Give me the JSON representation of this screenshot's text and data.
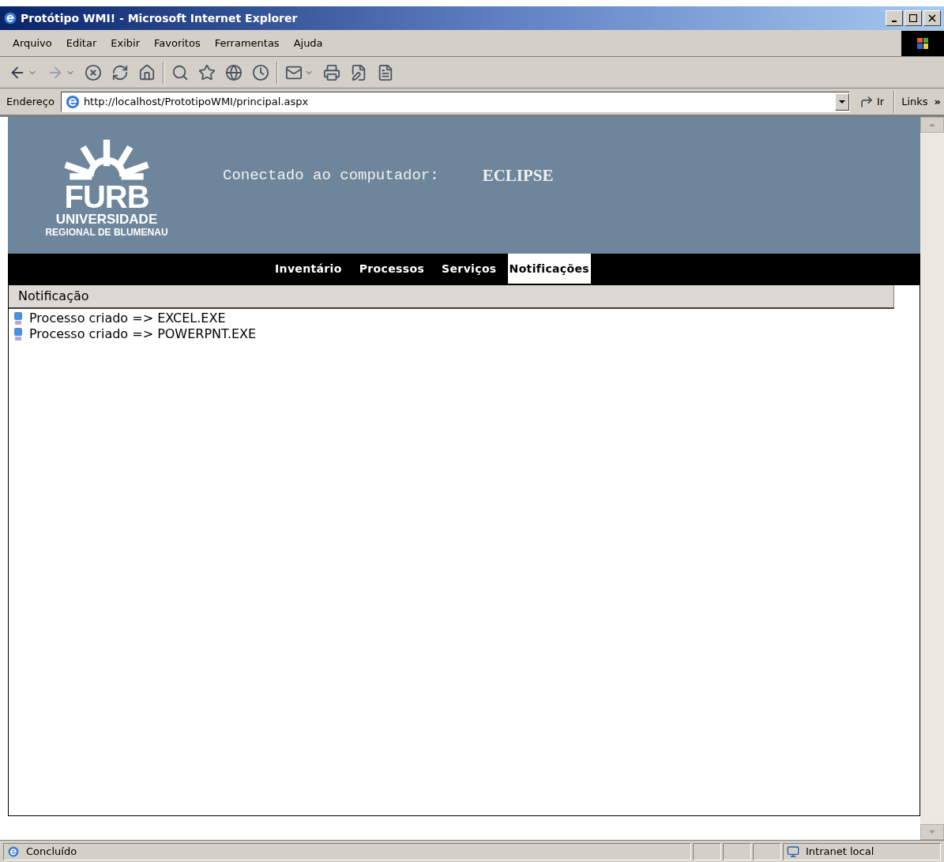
{
  "window": {
    "title": "Protótipo WMI! - Microsoft Internet Explorer"
  },
  "menu": [
    "Arquivo",
    "Editar",
    "Exibir",
    "Favoritos",
    "Ferramentas",
    "Ajuda"
  ],
  "address_bar": {
    "label": "Endereço",
    "value": "http://localhost/PrototipoWMI/principal.aspx",
    "go": "Ir",
    "links": "Links",
    "more": "»"
  },
  "header": {
    "logo": {
      "name": "FURB",
      "line1": "UNIVERSIDADE",
      "line2": "REGIONAL DE BLUMENAU"
    },
    "connected_label": "Conectado ao computador:",
    "computer": "ECLIPSE"
  },
  "nav_tabs": [
    {
      "label": "Inventário",
      "selected": false
    },
    {
      "label": "Processos",
      "selected": false
    },
    {
      "label": "Serviços",
      "selected": false
    },
    {
      "label": "Notificações",
      "selected": true
    }
  ],
  "panel": {
    "title": "Notificação",
    "items": [
      "Processo criado => EXCEL.EXE",
      "Processo criado => POWERPNT.EXE"
    ]
  },
  "status_bar": {
    "text": "Concluído",
    "zone": "Intranet local"
  }
}
